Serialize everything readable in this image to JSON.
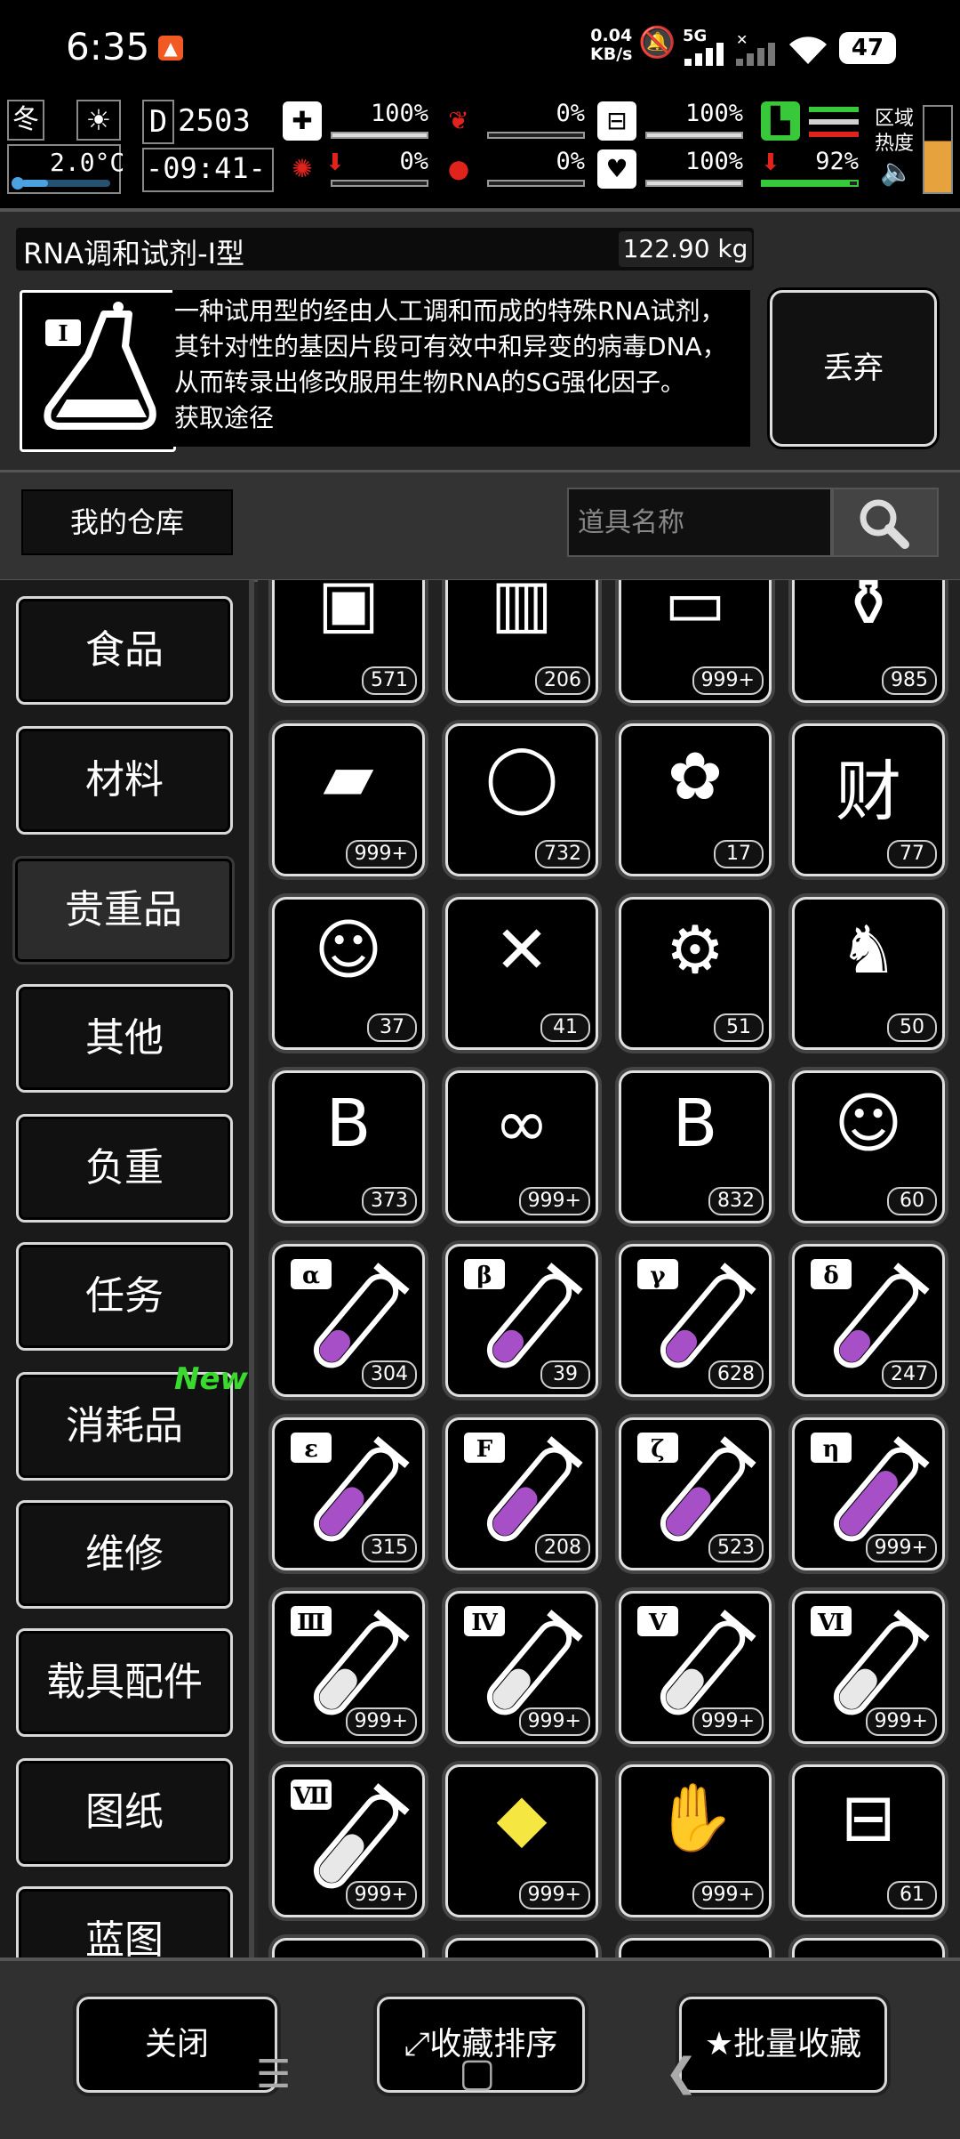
{
  "status_bar": {
    "time": "6:35",
    "net_speed_value": "0.04",
    "net_speed_unit": "KB/s",
    "signal_label": "5G",
    "battery": "47"
  },
  "hud": {
    "season": "冬",
    "temperature": "2.0°C",
    "day": "2503",
    "clock": "-09:41-",
    "stats": [
      {
        "name": "health-kit",
        "value": "100%",
        "fill": 1.0
      },
      {
        "name": "stomach",
        "value": "0%",
        "fill": 0.0
      },
      {
        "name": "water-tank",
        "value": "100%",
        "fill": 1.0
      },
      {
        "name": "brain",
        "value": "0%",
        "fill": 0.0
      },
      {
        "name": "blood",
        "value": "0%",
        "fill": 0.0
      },
      {
        "name": "heart",
        "value": "100%",
        "fill": 1.0
      },
      {
        "name": "stamina",
        "value": "92%",
        "fill": 0.92
      }
    ],
    "zone_label_1": "区域",
    "zone_label_2": "热度"
  },
  "item": {
    "name": "RNA调和试剂-Ⅰ型",
    "weight": "122.90 kg",
    "description": "一种试用型的经由人工调和而成的特殊RNA试剂，其针对性的基因片段可有效中和异变的病毒DNA，从而转录出修改服用生物RNA的SG强化因子。",
    "description_cut": "获取途径",
    "icon_badge": "I",
    "discard_label": "丢弃"
  },
  "warehouse": {
    "label": "我的仓库",
    "search_placeholder": "道具名称"
  },
  "categories": [
    {
      "label": "食品"
    },
    {
      "label": "材料"
    },
    {
      "label": "贵重品"
    },
    {
      "label": "其他"
    },
    {
      "label": "负重"
    },
    {
      "label": "任务"
    },
    {
      "label": "消耗品"
    },
    {
      "label": "维修"
    },
    {
      "label": "载具配件"
    },
    {
      "label": "图纸"
    },
    {
      "label": "蓝图"
    }
  ],
  "new_badge": "New",
  "items": [
    {
      "icon": "treasure-chest-icon",
      "glyph": "▣",
      "count": "571"
    },
    {
      "icon": "canned-food-icon",
      "glyph": "▥",
      "count": "206"
    },
    {
      "icon": "cash-bundle-icon",
      "glyph": "▭",
      "count": "999+"
    },
    {
      "icon": "vase-icon",
      "glyph": "⚱",
      "count": "985"
    },
    {
      "icon": "gold-bars-icon",
      "glyph": "▰",
      "count": "999+"
    },
    {
      "icon": "diamond-ring-icon",
      "glyph": "◯",
      "count": "732"
    },
    {
      "icon": "rabbit-seed-bag-icon",
      "glyph": "✿",
      "count": "17"
    },
    {
      "icon": "fortune-bag-icon",
      "glyph": "财",
      "count": "77"
    },
    {
      "icon": "portrait-ticket-icon",
      "glyph": "☺",
      "count": "37"
    },
    {
      "icon": "crossed-ticket-icon",
      "glyph": "✕",
      "count": "41"
    },
    {
      "icon": "robot-parts-icon",
      "glyph": "⚙",
      "count": "51"
    },
    {
      "icon": "robot-figure-icon",
      "glyph": "♞",
      "count": "50"
    },
    {
      "icon": "scroll-icon",
      "glyph": "B",
      "count": "373"
    },
    {
      "icon": "dna-ticket-icon",
      "glyph": "∞",
      "count": "999+"
    },
    {
      "icon": "b-coin-bag-icon",
      "glyph": "B",
      "count": "832"
    },
    {
      "icon": "portrait-ticket-2-icon",
      "glyph": "☺",
      "count": "60"
    },
    {
      "icon": "test-tube-alpha-icon",
      "label": "α",
      "fill": 0.35,
      "liquid": "#a64fc6",
      "count": "304"
    },
    {
      "icon": "test-tube-beta-icon",
      "label": "β",
      "fill": 0.35,
      "liquid": "#a64fc6",
      "count": "39"
    },
    {
      "icon": "test-tube-gamma-icon",
      "label": "γ",
      "fill": 0.35,
      "liquid": "#a64fc6",
      "count": "628"
    },
    {
      "icon": "test-tube-delta-icon",
      "label": "δ",
      "fill": 0.35,
      "liquid": "#a64fc6",
      "count": "247"
    },
    {
      "icon": "test-tube-epsilon-icon",
      "label": "ε",
      "fill": 0.55,
      "liquid": "#a64fc6",
      "count": "315"
    },
    {
      "icon": "test-tube-f-icon",
      "label": "F",
      "fill": 0.55,
      "liquid": "#a64fc6",
      "count": "208"
    },
    {
      "icon": "test-tube-zeta-icon",
      "label": "ζ",
      "fill": 0.55,
      "liquid": "#a64fc6",
      "count": "523"
    },
    {
      "icon": "test-tube-eta-icon",
      "label": "η",
      "fill": 0.75,
      "liquid": "#a64fc6",
      "count": "999+"
    },
    {
      "icon": "test-tube-iii-icon",
      "label": "Ⅲ",
      "fill": 0.45,
      "liquid": "#e8e8e8",
      "count": "999+"
    },
    {
      "icon": "test-tube-iv-icon",
      "label": "Ⅳ",
      "fill": 0.45,
      "liquid": "#e8e8e8",
      "count": "999+"
    },
    {
      "icon": "test-tube-v-icon",
      "label": "Ⅴ",
      "fill": 0.45,
      "liquid": "#e8e8e8",
      "count": "999+"
    },
    {
      "icon": "test-tube-vi-icon",
      "label": "Ⅵ",
      "fill": 0.45,
      "liquid": "#e8e8e8",
      "count": "999+"
    },
    {
      "icon": "test-tube-vii-icon",
      "label": "Ⅶ",
      "fill": 0.55,
      "liquid": "#e8e8e8",
      "count": "999+"
    },
    {
      "icon": "yellow-crystal-icon",
      "glyph": "◆",
      "glyph_color": "#f5e642",
      "count": "999+"
    },
    {
      "icon": "specimen-poster-icon",
      "glyph": "✋",
      "count": "999+"
    },
    {
      "icon": "toolbox-icon",
      "glyph": "⊟",
      "count": "61"
    }
  ],
  "bottom": {
    "close_label": "关闭",
    "sort_label": "收藏排序",
    "batch_label": "批量收藏"
  },
  "colors": {
    "accent_new": "#39d92f",
    "potion_purple": "#a64fc6",
    "status_red": "#e0231c",
    "stamina_green": "#37c93a"
  }
}
